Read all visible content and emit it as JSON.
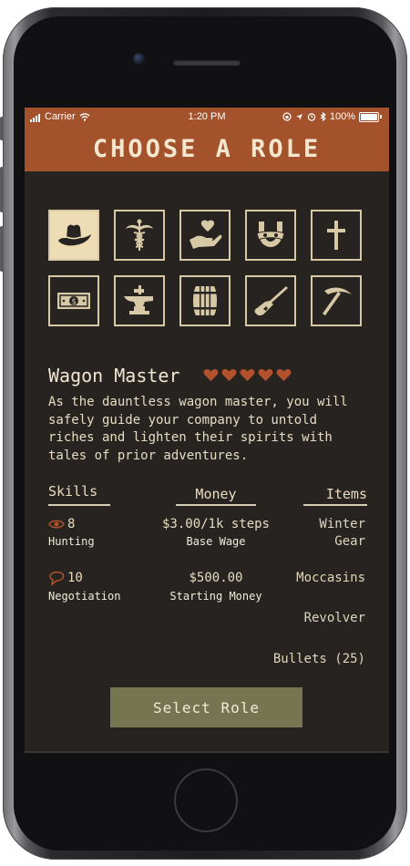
{
  "status_bar": {
    "carrier": "Carrier",
    "time": "1:20 PM",
    "battery": "100%"
  },
  "header": {
    "title": "CHOOSE A ROLE"
  },
  "roles": [
    {
      "icon": "cowboy-hat-icon",
      "selected": true
    },
    {
      "icon": "caduceus-icon",
      "selected": false
    },
    {
      "icon": "heart-in-hand-icon",
      "selected": false
    },
    {
      "icon": "horseshoe-mask-icon",
      "selected": false
    },
    {
      "icon": "cross-icon",
      "selected": false
    },
    {
      "icon": "money-bill-icon",
      "selected": false
    },
    {
      "icon": "anvil-icon",
      "selected": false
    },
    {
      "icon": "barrel-icon",
      "selected": false
    },
    {
      "icon": "rifle-icon",
      "selected": false
    },
    {
      "icon": "pickaxe-icon",
      "selected": false
    }
  ],
  "role": {
    "name": "Wagon Master",
    "hearts": 5,
    "description": "As the dauntless wagon master, you will safely guide your company to untold riches and lighten their spirits with tales of prior adventures."
  },
  "columns": {
    "skills": "Skills",
    "money": "Money",
    "items": "Items"
  },
  "skills": [
    {
      "icon": "eye-icon",
      "value": "8",
      "label": "Hunting"
    },
    {
      "icon": "speech-bubble-icon",
      "value": "10",
      "label": "Negotiation"
    }
  ],
  "money": [
    {
      "value": "$3.00/1k steps",
      "label": "Base Wage"
    },
    {
      "value": "$500.00",
      "label": "Starting Money"
    }
  ],
  "items": [
    "Winter\nGear",
    "Moccasins",
    "Revolver",
    "Bullets (25)"
  ],
  "select_button": "Select Role",
  "colors": {
    "header": "#a4522b",
    "background": "#262320",
    "tile_border": "#d8c9a6",
    "selected_tile": "#eedcb4",
    "button": "#767552",
    "heart": "#b2522c"
  }
}
